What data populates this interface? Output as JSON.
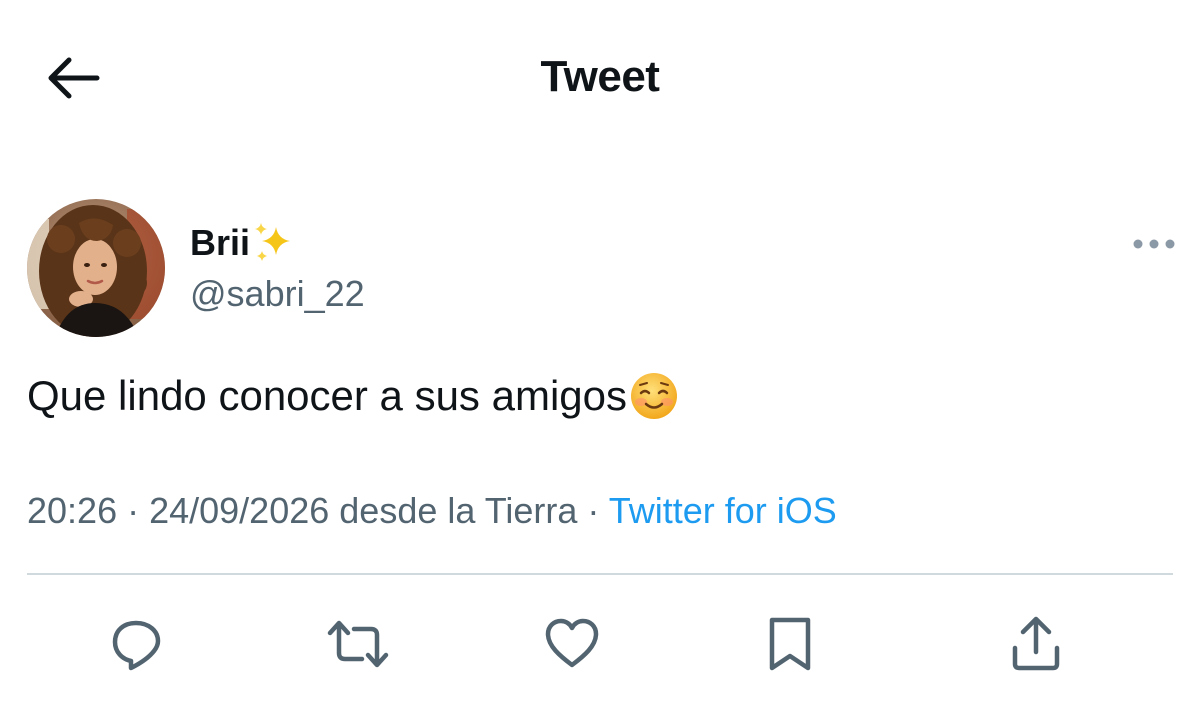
{
  "header": {
    "title": "Tweet",
    "back_icon": "arrow-left-icon"
  },
  "tweet": {
    "author": {
      "display_name": "Brii",
      "name_emoji": "sparkles-icon",
      "handle": "@sabri_22"
    },
    "text": "Que lindo conocer a sus amigos",
    "text_emoji": "smiling-face-icon",
    "meta": {
      "time": "20:26",
      "separator": " · ",
      "date": "24/09/2026",
      "location": " desde la Tierra",
      "source": "Twitter for iOS"
    }
  },
  "actions": [
    "reply-icon",
    "retweet-icon",
    "like-icon",
    "bookmark-icon",
    "share-icon"
  ],
  "colors": {
    "text": "#0f1419",
    "secondary": "#536471",
    "link": "#1d9bf0",
    "divider": "#cfd9de"
  }
}
